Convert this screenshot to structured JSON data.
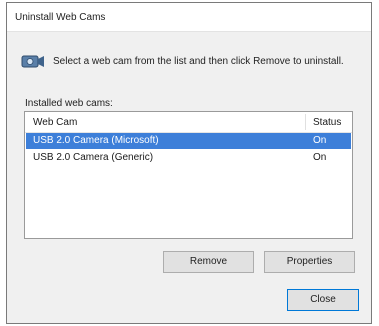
{
  "window": {
    "title": "Uninstall Web Cams"
  },
  "header": {
    "description": "Select a web cam from the list and then click Remove to uninstall."
  },
  "group": {
    "label": "Installed web cams:"
  },
  "list": {
    "columns": [
      "Web Cam",
      "Status"
    ],
    "rows": [
      {
        "name": "USB 2.0 Camera (Microsoft)",
        "status": "On",
        "selected": true
      },
      {
        "name": "USB 2.0 Camera (Generic)",
        "status": "On",
        "selected": false
      }
    ]
  },
  "buttons": {
    "remove": "Remove",
    "properties": "Properties",
    "close": "Close"
  },
  "colors": {
    "selection": "#3d7fd9",
    "close_button_border": "#0078d7"
  }
}
